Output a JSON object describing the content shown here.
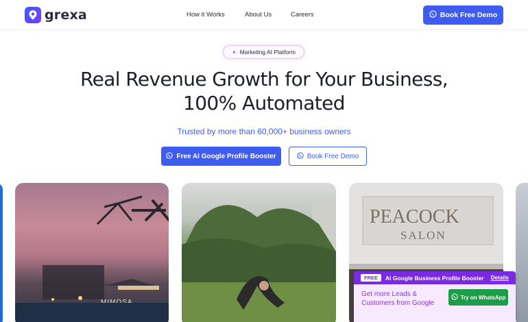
{
  "header": {
    "logo_text": "grexa",
    "nav": [
      "How it Works",
      "About Us",
      "Careers"
    ],
    "cta_label": "Book Free Demo"
  },
  "hero": {
    "pill_label": "Marketing AI Platform",
    "headline_line1": "Real Revenue Growth for Your Business,",
    "headline_line2": "100% Automated",
    "trusted_text": "Trusted by more than 60,000+ business owners",
    "primary_cta": "Free AI Google Profile Booster",
    "secondary_cta": "Book Free Demo"
  },
  "cards": {
    "card1_sign": "MIMOSA",
    "card3_sign_line1": "PEACOCK",
    "card3_sign_line2": "SALON"
  },
  "booster": {
    "badge": "FREE",
    "title": "AI Google Business Profile Booster",
    "details": "Details",
    "body_line1": "Get more Leads &",
    "body_line2": "Customers from Google",
    "button_label": "Try on WhatsApp"
  },
  "colors": {
    "brand_blue": "#3e5cf0",
    "brand_purple": "#7a2be2",
    "whatsapp_green": "#1e9c47"
  },
  "icons": [
    "logo-mark-icon",
    "whatsapp-icon",
    "sparkle-icon"
  ]
}
